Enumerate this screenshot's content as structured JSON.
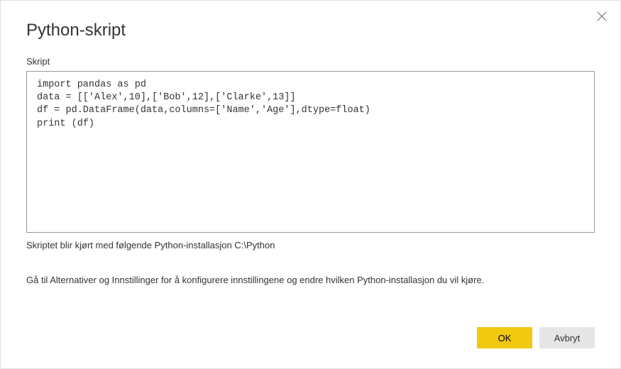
{
  "dialog": {
    "title": "Python-skript",
    "field_label": "Skript",
    "script_content": "import pandas as pd\ndata = [['Alex',10],['Bob',12],['Clarke',13]]\ndf = pd.DataFrame(data,columns=['Name','Age'],dtype=float)\nprint (df)",
    "install_info": "Skriptet blir kjørt med følgende Python-installasjon C:\\Python",
    "help_text": "Gå til Alternativer og Innstillinger for å konfigurere innstillingene og endre hvilken Python-installasjon du vil kjøre.",
    "buttons": {
      "ok": "OK",
      "cancel": "Avbryt"
    }
  },
  "colors": {
    "primary": "#F2C811",
    "secondary": "#e6e6e6"
  }
}
